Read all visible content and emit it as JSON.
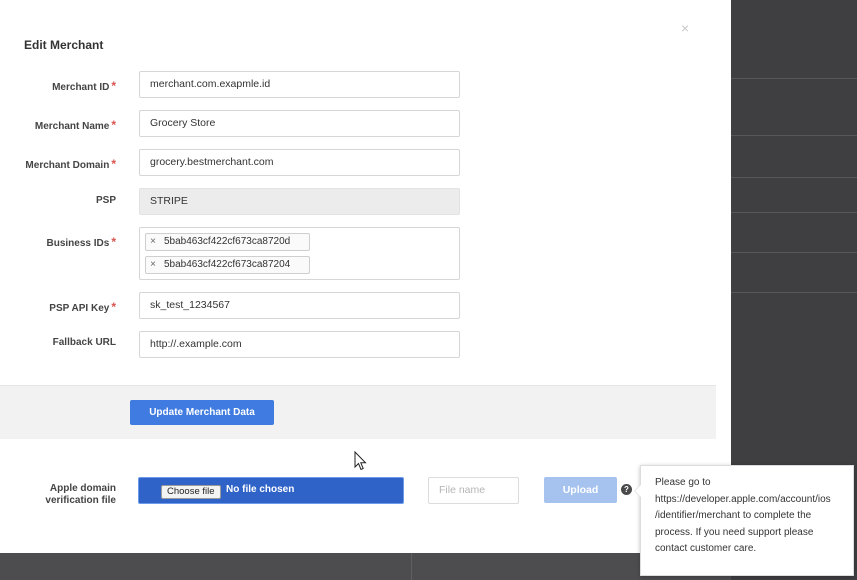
{
  "modal": {
    "title": "Edit Merchant",
    "close_glyph": "×",
    "required_marker": "*"
  },
  "fields": {
    "merchant_id": {
      "label": "Merchant ID",
      "value": "merchant.com.exapmle.id"
    },
    "merchant_name": {
      "label": "Merchant Name",
      "value": "Grocery Store"
    },
    "merchant_domain": {
      "label": "Merchant Domain",
      "value": "grocery.bestmerchant.com"
    },
    "psp": {
      "label": "PSP",
      "value": "STRIPE"
    },
    "business_ids": {
      "label": "Business IDs",
      "tags": [
        "5bab463cf422cf673ca8720d",
        "5bab463cf422cf673ca87204"
      ]
    },
    "psp_api_key": {
      "label": "PSP API Key",
      "value": "sk_test_1234567"
    },
    "fallback_url": {
      "label": "Fallback URL",
      "value": "http://.example.com"
    }
  },
  "actions": {
    "update_label": "Update Merchant Data"
  },
  "apple_upload": {
    "label_line1": "Apple domain",
    "label_line2": "verification file",
    "choose_label": "Choose file",
    "no_file_label": "No file chosen",
    "filename_placeholder": "File name",
    "upload_label": "Upload",
    "help_glyph": "?"
  },
  "tooltip": {
    "lines": [
      "Please go to",
      "https://developer.apple.com/account/ios",
      "/identifier/merchant to complete the",
      "process. If you need support please",
      "contact customer care."
    ]
  },
  "colors": {
    "primary": "#3f7be0",
    "required": "#d9534f",
    "upload_disabled": "#a6c2ee"
  },
  "icons": {
    "close": "close-icon",
    "tag_remove": "remove-tag-icon",
    "help": "help-icon",
    "cursor": "mouse-cursor-icon"
  }
}
